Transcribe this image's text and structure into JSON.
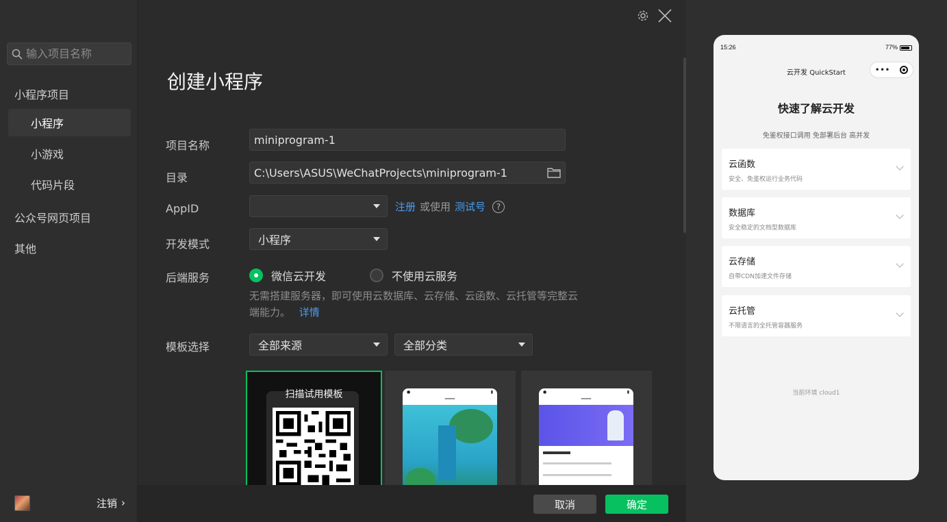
{
  "sidebar": {
    "search_placeholder": "输入项目名称",
    "group_miniprogram": "小程序项目",
    "items": [
      {
        "label": "小程序"
      },
      {
        "label": "小游戏"
      },
      {
        "label": "代码片段"
      }
    ],
    "group_web": "公众号网页项目",
    "group_other": "其他",
    "logout": "注销",
    "logout_arrow": "›"
  },
  "main": {
    "title": "创建小程序",
    "labels": {
      "name": "项目名称",
      "dir": "目录",
      "appid": "AppID",
      "mode": "开发模式",
      "backend": "后端服务",
      "template": "模板选择"
    },
    "name_value": "miniprogram-1",
    "dir_value": "C:\\Users\\ASUS\\WeChatProjects\\miniprogram-1",
    "appid_value": "",
    "appid_register": "注册",
    "appid_or": "或使用",
    "appid_test": "测试号",
    "help": "?",
    "mode_value": "小程序",
    "backend_option_1": "微信云开发",
    "backend_option_2": "不使用云服务",
    "backend_desc": "无需搭建服务器，即可使用云数据库、云存储、云函数、云托管等完整云端能力。",
    "backend_link": "详情",
    "source_select": "全部来源",
    "category_select": "全部分类",
    "template_scan": "扫描试用模板",
    "cancel": "取消",
    "confirm": "确定"
  },
  "preview": {
    "time": "15:26",
    "battery": "77%",
    "nav_title": "云开发 QuickStart",
    "headline": "快速了解云开发",
    "subline": "免鉴权接口调用 免部署后台 高并发",
    "cards": [
      {
        "title": "云函数",
        "desc": "安全、免鉴权运行业务代码"
      },
      {
        "title": "数据库",
        "desc": "安全稳定的文档型数据库"
      },
      {
        "title": "云存储",
        "desc": "自带CDN加速文件存储"
      },
      {
        "title": "云托管",
        "desc": "不限语言的全托管容器服务"
      }
    ],
    "env": "当前环境 cloud1"
  },
  "colors": {
    "accent": "#07c160",
    "link": "#4a9df2"
  }
}
